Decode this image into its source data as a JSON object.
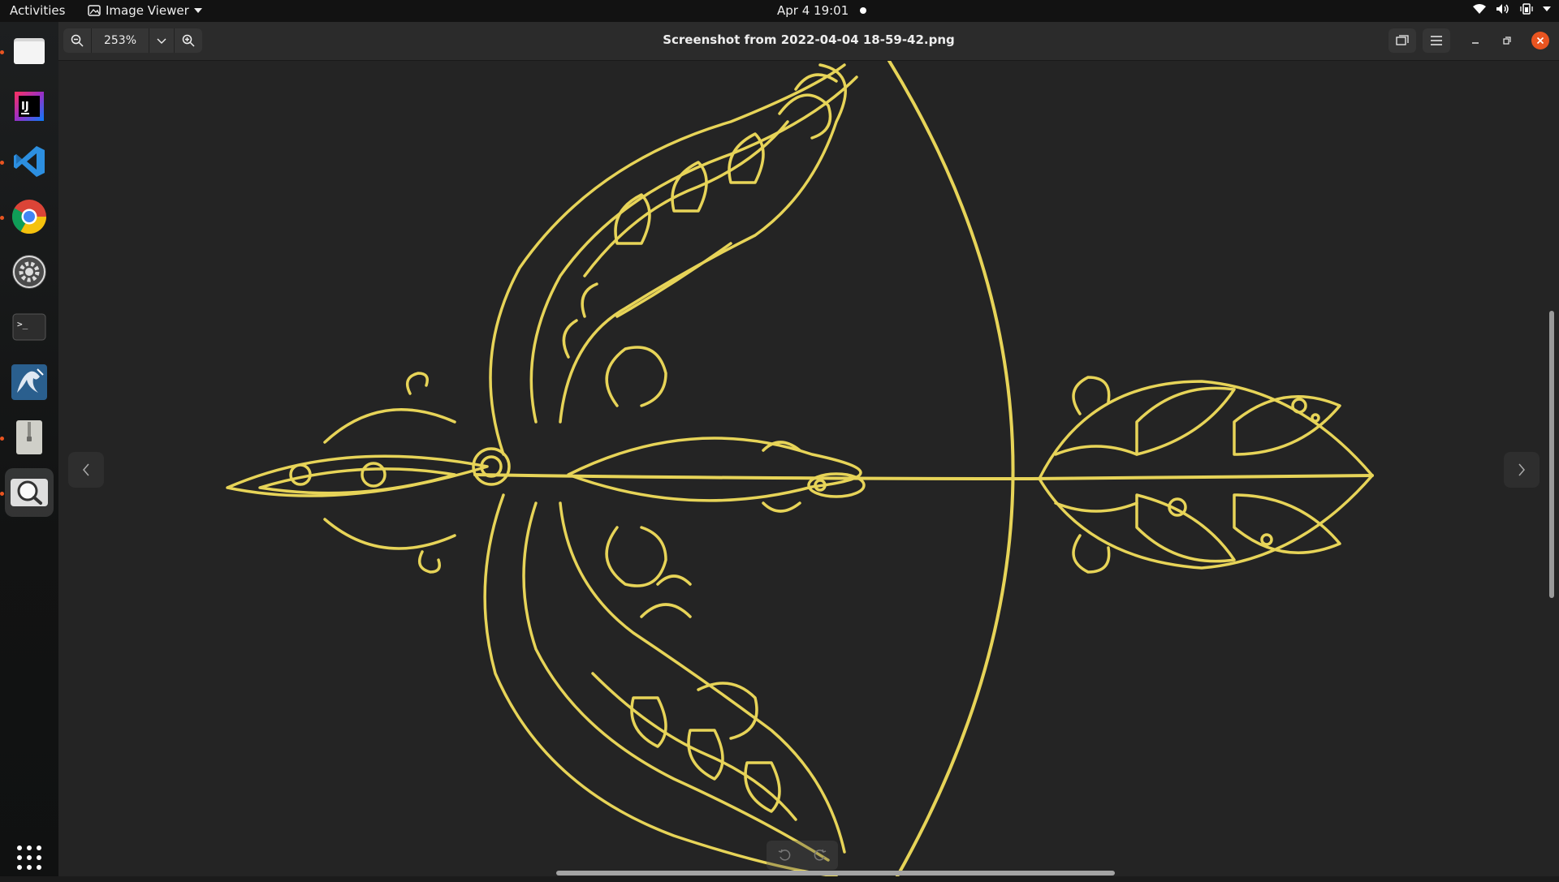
{
  "topbar": {
    "activities": "Activities",
    "app_name": "Image Viewer",
    "clock": "Apr 4  19:01",
    "icons": [
      "wifi-icon",
      "volume-icon",
      "battery-icon",
      "system-menu-icon"
    ]
  },
  "dock": {
    "items": [
      {
        "name": "files",
        "running": true
      },
      {
        "name": "intellij-idea",
        "running": false
      },
      {
        "name": "visual-studio-code",
        "running": true
      },
      {
        "name": "google-chrome",
        "running": true
      },
      {
        "name": "settings",
        "running": false
      },
      {
        "name": "terminal",
        "running": false
      },
      {
        "name": "mysql-workbench",
        "running": false
      },
      {
        "name": "archive-manager",
        "running": true
      },
      {
        "name": "image-viewer",
        "running": true,
        "active": true
      }
    ],
    "show_apps_icon": "grid-icon"
  },
  "window": {
    "title": "Screenshot from 2022-04-04 18-59-42.png",
    "zoom": "253%",
    "image_color": "#e7d458",
    "background": "#242424"
  }
}
